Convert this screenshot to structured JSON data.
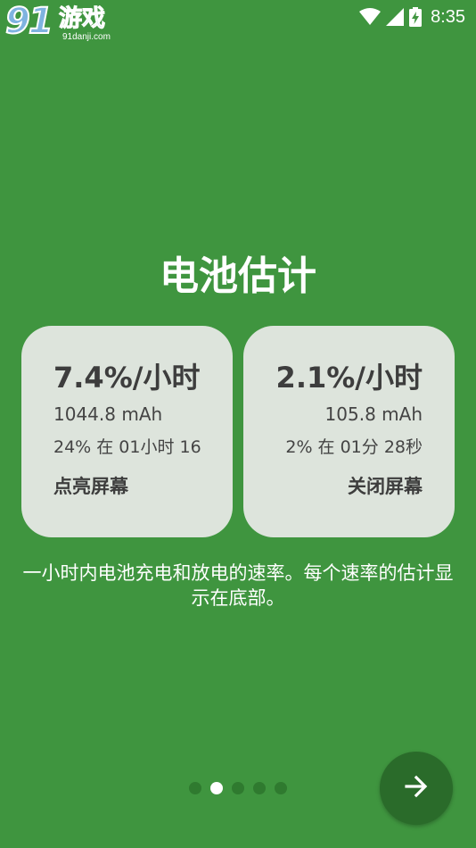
{
  "status_bar": {
    "watermark_number": "91",
    "watermark_text": "游戏",
    "watermark_domain": "91danji.com",
    "time": "8:35",
    "icons": [
      "wifi-icon",
      "signal-icon",
      "battery-charging-icon"
    ]
  },
  "page": {
    "title": "电池估计",
    "description": "一小时内电池充电和放电的速率。每个速率的估计显示在底部。"
  },
  "cards": [
    {
      "rate": "7.4%/小时",
      "mah": "1044.8 mAh",
      "detail": "24% 在 01小时 16",
      "label": "点亮屏幕"
    },
    {
      "rate": "2.1%/小时",
      "mah": "105.8 mAh",
      "detail": "2% 在 01分 28秒",
      "label": "关闭屏幕"
    }
  ],
  "pager": {
    "total": 5,
    "active_index": 1
  },
  "next_button": {
    "icon": "arrow-right-icon"
  },
  "colors": {
    "background": "#3f953f",
    "card": "#dde4dc",
    "button": "#2a6b2a",
    "dot_inactive": "#2f7a2f",
    "dot_active": "#ffffff"
  }
}
